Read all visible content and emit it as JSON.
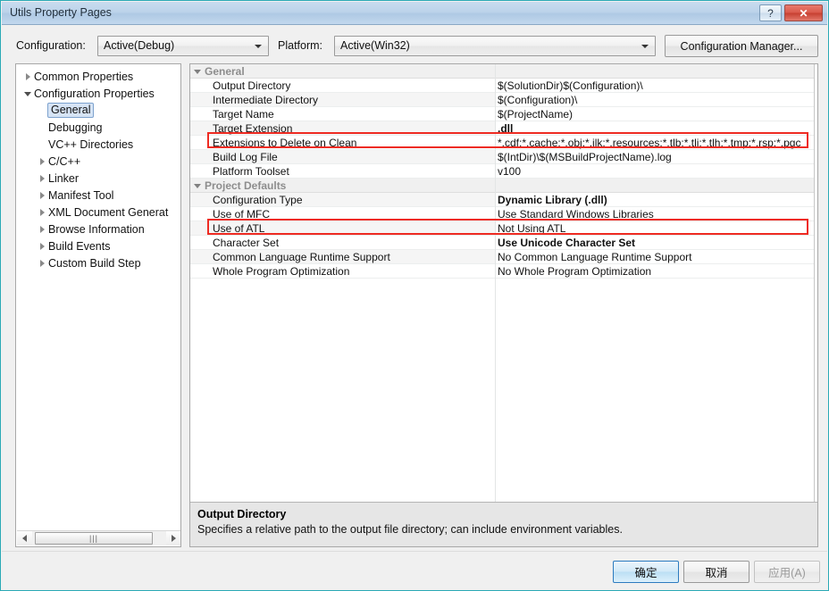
{
  "window": {
    "title": "Utils Property Pages",
    "help_button": "?",
    "close_button": "✕"
  },
  "config_bar": {
    "configuration_label": "Configuration:",
    "configuration_value": "Active(Debug)",
    "platform_label": "Platform:",
    "platform_value": "Active(Win32)",
    "configuration_manager_button": "Configuration Manager..."
  },
  "tree": {
    "items": [
      {
        "label": "Common Properties",
        "indent": 0,
        "toggle": "collapsed",
        "selected": false
      },
      {
        "label": "Configuration Properties",
        "indent": 0,
        "toggle": "expanded",
        "selected": false
      },
      {
        "label": "General",
        "indent": 1,
        "toggle": "blank",
        "selected": true
      },
      {
        "label": "Debugging",
        "indent": 1,
        "toggle": "blank",
        "selected": false
      },
      {
        "label": "VC++ Directories",
        "indent": 1,
        "toggle": "blank",
        "selected": false
      },
      {
        "label": "C/C++",
        "indent": 1,
        "toggle": "collapsed",
        "selected": false
      },
      {
        "label": "Linker",
        "indent": 1,
        "toggle": "collapsed",
        "selected": false
      },
      {
        "label": "Manifest Tool",
        "indent": 1,
        "toggle": "collapsed",
        "selected": false
      },
      {
        "label": "XML Document Generat",
        "indent": 1,
        "toggle": "collapsed",
        "selected": false
      },
      {
        "label": "Browse Information",
        "indent": 1,
        "toggle": "collapsed",
        "selected": false
      },
      {
        "label": "Build Events",
        "indent": 1,
        "toggle": "collapsed",
        "selected": false
      },
      {
        "label": "Custom Build Step",
        "indent": 1,
        "toggle": "collapsed",
        "selected": false
      }
    ],
    "scrollbar": {
      "left_arrow": "◄",
      "right_arrow": "►",
      "grip": "|||"
    }
  },
  "grid": {
    "rows": [
      {
        "type": "group",
        "name": "General"
      },
      {
        "type": "prop",
        "name": "Output Directory",
        "value": "$(SolutionDir)$(Configuration)\\",
        "bold": false
      },
      {
        "type": "prop",
        "name": "Intermediate Directory",
        "value": "$(Configuration)\\",
        "bold": false
      },
      {
        "type": "prop",
        "name": "Target Name",
        "value": "$(ProjectName)",
        "bold": false
      },
      {
        "type": "prop",
        "name": "Target Extension",
        "value": ".dll",
        "bold": true
      },
      {
        "type": "prop",
        "name": "Extensions to Delete on Clean",
        "value": "*.cdf;*.cache;*.obj;*.ilk;*.resources;*.tlb;*.tli;*.tlh;*.tmp;*.rsp;*.pgc",
        "bold": false
      },
      {
        "type": "prop",
        "name": "Build Log File",
        "value": "$(IntDir)\\$(MSBuildProjectName).log",
        "bold": false
      },
      {
        "type": "prop",
        "name": "Platform Toolset",
        "value": "v100",
        "bold": false
      },
      {
        "type": "group",
        "name": "Project Defaults"
      },
      {
        "type": "prop",
        "name": "Configuration Type",
        "value": "Dynamic Library (.dll)",
        "bold": true
      },
      {
        "type": "prop",
        "name": "Use of MFC",
        "value": "Use Standard Windows Libraries",
        "bold": false
      },
      {
        "type": "prop",
        "name": "Use of ATL",
        "value": "Not Using ATL",
        "bold": false
      },
      {
        "type": "prop",
        "name": "Character Set",
        "value": "Use Unicode Character Set",
        "bold": true
      },
      {
        "type": "prop",
        "name": "Common Language Runtime Support",
        "value": "No Common Language Runtime Support",
        "bold": false
      },
      {
        "type": "prop",
        "name": "Whole Program Optimization",
        "value": "No Whole Program Optimization",
        "bold": false
      }
    ]
  },
  "description": {
    "title": "Output Directory",
    "body": "Specifies a relative path to the output file directory; can include environment variables."
  },
  "highlights": {
    "accent_color": "#ee2b22",
    "boxes": [
      "Target Extension",
      "Configuration Type"
    ]
  },
  "footer": {
    "ok_label": "确定",
    "cancel_label": "取消",
    "apply_label": "应用(A)"
  }
}
